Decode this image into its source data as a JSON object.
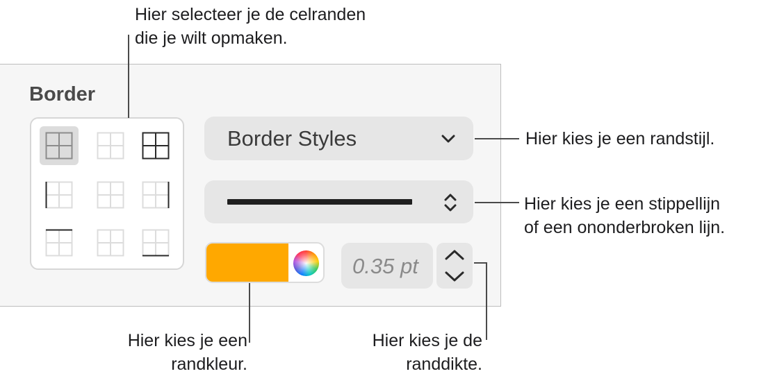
{
  "panel": {
    "section_title": "Border",
    "border_style_select": {
      "label": "Border Styles",
      "icon": "chevron-down-icon"
    },
    "line_style_select": {
      "value": "solid line",
      "icon": "up-down-chevron-icon"
    },
    "border_color": {
      "color": "#FFA800",
      "icon": "color-wheel-icon"
    },
    "border_width": {
      "value": "0.35 pt"
    },
    "border_buttons": [
      {
        "name": "all-borders",
        "selected": true
      },
      {
        "name": "inside-borders",
        "selected": false
      },
      {
        "name": "outside-borders",
        "selected": false
      },
      {
        "name": "left-border",
        "selected": false
      },
      {
        "name": "inside-vertical-border",
        "selected": false
      },
      {
        "name": "right-border",
        "selected": false
      },
      {
        "name": "top-border",
        "selected": false
      },
      {
        "name": "inside-horizontal-border",
        "selected": false
      },
      {
        "name": "bottom-border",
        "selected": false
      }
    ]
  },
  "callouts": {
    "select_borders": [
      "Hier selecteer je de celranden",
      "die je wilt opmaken."
    ],
    "border_style": [
      "Hier kies je een randstijl."
    ],
    "line_type": [
      "Hier kies je een stippellijn",
      "of een ononderbroken lijn."
    ],
    "border_color": [
      "Hier kies je een",
      "randkleur."
    ],
    "border_width": [
      "Hier kies je de",
      "randdikte."
    ]
  }
}
